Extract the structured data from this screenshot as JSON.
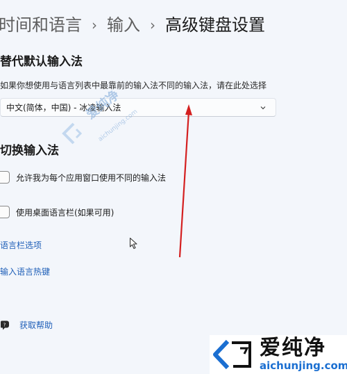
{
  "breadcrumb": {
    "items": [
      "时间和语言",
      "输入"
    ],
    "current": "高级键盘设置",
    "separator": "›"
  },
  "override_section": {
    "title": "替代默认输入法",
    "description": "如果你想使用与语言列表中最靠前的输入法不同的输入法，请在此处选择",
    "dropdown_value": "中文(简体，中国) - 冰凌输入法"
  },
  "switch_section": {
    "title": "切换输入法",
    "checkboxes": [
      {
        "label": "允许我为每个应用窗口使用不同的输入法",
        "checked": false
      },
      {
        "label": "使用桌面语言栏(如果可用)",
        "checked": false
      }
    ]
  },
  "links": {
    "language_bar_options": "语言栏选项",
    "input_language_hotkeys": "输入语言热键"
  },
  "help": {
    "label": "获取帮助",
    "icon": "help-icon"
  },
  "watermark": {
    "center_text": "爱纯净",
    "center_sub": "aichunjing.com",
    "brand_cn": "爱纯净",
    "brand_en": "aichunjing.com"
  },
  "colors": {
    "background": "#f3f6fb",
    "link": "#1f5fb8",
    "annotation_arrow": "#d42020",
    "brand_blue": "#1b6fd1"
  }
}
